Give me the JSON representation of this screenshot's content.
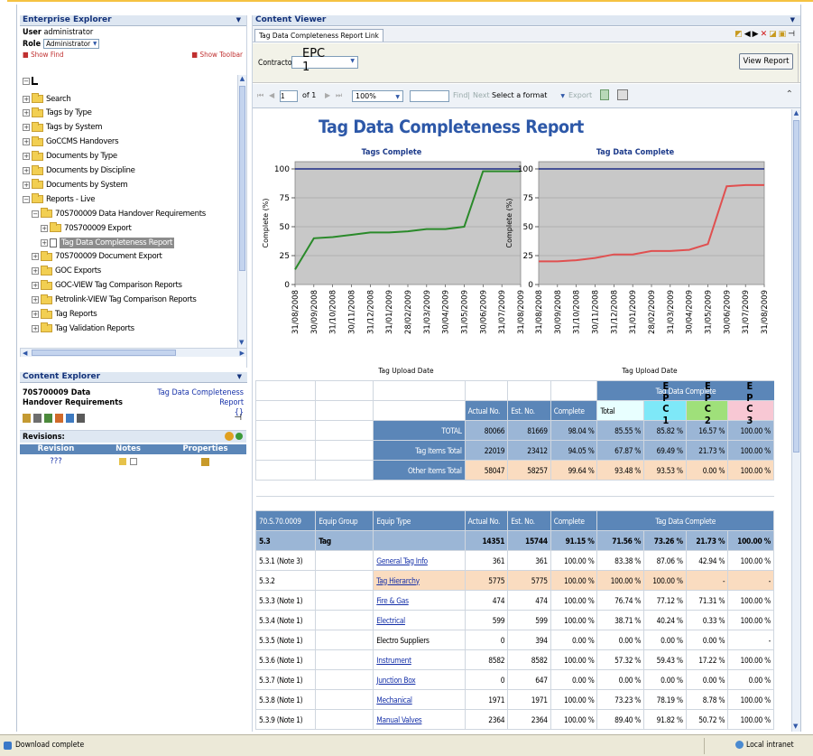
{
  "window": {
    "status": "Download complete",
    "zone": "Local intranet"
  },
  "enterprise_explorer": {
    "title": "Enterprise Explorer",
    "user_label": "User",
    "user_value": "administrator",
    "role_label": "Role",
    "role_value": "Administrator",
    "show_find": "Show Find",
    "show_toolbar": "Show Toolbar",
    "tree": [
      {
        "label": "Search",
        "indent": 1,
        "type": "folder"
      },
      {
        "label": "Tags by Type",
        "indent": 1,
        "type": "folder"
      },
      {
        "label": "Tags by System",
        "indent": 1,
        "type": "folder"
      },
      {
        "label": "GoCCMS Handovers",
        "indent": 1,
        "type": "folder"
      },
      {
        "label": "Documents by Type",
        "indent": 1,
        "type": "folder"
      },
      {
        "label": "Documents by Discipline",
        "indent": 1,
        "type": "folder"
      },
      {
        "label": "Documents by System",
        "indent": 1,
        "type": "folder"
      },
      {
        "label": "Reports - Live",
        "indent": 1,
        "type": "folder"
      },
      {
        "label": "70S700009 Data Handover Requirements",
        "indent": 2,
        "type": "folder"
      },
      {
        "label": "70S700009 Export",
        "indent": 3,
        "type": "folder"
      },
      {
        "label": "Tag Data Completeness Report",
        "indent": 3,
        "type": "doc"
      },
      {
        "label": "70S700009 Document Export",
        "indent": 2,
        "type": "folder"
      },
      {
        "label": "GOC Exports",
        "indent": 2,
        "type": "folder"
      },
      {
        "label": "GOC-VIEW Tag Comparison Reports",
        "indent": 2,
        "type": "folder"
      },
      {
        "label": "Petrolink-VIEW Tag Comparison Reports",
        "indent": 2,
        "type": "folder"
      },
      {
        "label": "Tag Reports",
        "indent": 2,
        "type": "folder"
      },
      {
        "label": "Tag Validation Reports",
        "indent": 2,
        "type": "folder"
      }
    ]
  },
  "content_explorer": {
    "title": "Content Explorer",
    "doc_title": "70S700009 Data Handover Requirements",
    "report_link": "Tag Data Completeness Report",
    "braces": "{}",
    "revisions_label": "Revisions:",
    "columns": [
      "Revision",
      "Notes",
      "Properties"
    ],
    "revision_value": "???"
  },
  "content_viewer": {
    "title": "Content Viewer",
    "tab_label": "Tag Data Completeness Report Link",
    "contractor_label": "Contractor",
    "contractor_value": "EPC 1",
    "view_report": "View Report",
    "toolbar": {
      "page_value": "1",
      "of_pages": "of 1",
      "zoom": "100%",
      "find": "Find",
      "separator": "|",
      "next": "Next",
      "format": "Select a format",
      "export": "Export"
    }
  },
  "report": {
    "title": "Tag Data Completeness Report",
    "summary": {
      "group_header": "Tag Data Complete",
      "columns": [
        "Actual No.",
        "Est. No.",
        "Complete",
        "Total",
        "EPC 1",
        "EPC 2",
        "EPC 3"
      ],
      "rows": [
        {
          "label": "TOTAL",
          "values": [
            "80066",
            "81669",
            "98.04 %",
            "85.55 %",
            "85.82 %",
            "16.57 %",
            "100.00 %"
          ]
        },
        {
          "label": "Tag Items Total",
          "values": [
            "22019",
            "23412",
            "94.05 %",
            "67.87 %",
            "69.49 %",
            "21.73 %",
            "100.00 %"
          ]
        },
        {
          "label": "Other Items Total",
          "values": [
            "58047",
            "58257",
            "99.64 %",
            "93.48 %",
            "93.53 %",
            "0.00 %",
            "100.00 %"
          ]
        }
      ]
    },
    "detail": {
      "headers": [
        "70.S.70.0009",
        "Equip Group",
        "Equip Type",
        "Actual No.",
        "Est. No.",
        "Complete",
        "Tag Data Complete"
      ],
      "group_row": [
        "5.3",
        "Tag",
        "",
        "14351",
        "15744",
        "91.15 %",
        "71.56 %",
        "73.26 %",
        "21.73 %",
        "100.00 %"
      ],
      "rows": [
        [
          "5.3.1 (Note 3)",
          "",
          "General Tag Info",
          "361",
          "361",
          "100.00 %",
          "83.38 %",
          "87.06 %",
          "42.94 %",
          "100.00 %"
        ],
        [
          "5.3.2",
          "",
          "Tag Hierarchy",
          "5775",
          "5775",
          "100.00 %",
          "100.00 %",
          "100.00 %",
          "-",
          "-"
        ],
        [
          "5.3.3 (Note 1)",
          "",
          "Fire & Gas",
          "474",
          "474",
          "100.00 %",
          "76.74 %",
          "77.12 %",
          "71.31 %",
          "100.00 %"
        ],
        [
          "5.3.4 (Note 1)",
          "",
          "Electrical",
          "599",
          "599",
          "100.00 %",
          "38.71 %",
          "40.24 %",
          "0.33 %",
          "100.00 %"
        ],
        [
          "5.3.5 (Note 1)",
          "",
          "Electro Suppliers",
          "0",
          "394",
          "0.00 %",
          "0.00 %",
          "0.00 %",
          "0.00 %",
          "-"
        ],
        [
          "5.3.6 (Note 1)",
          "",
          "Instrument",
          "8582",
          "8582",
          "100.00 %",
          "57.32 %",
          "59.43 %",
          "17.22 %",
          "100.00 %"
        ],
        [
          "5.3.7 (Note 1)",
          "",
          "Junction Box",
          "0",
          "647",
          "0.00 %",
          "0.00 %",
          "0.00 %",
          "0.00 %",
          "0.00 %"
        ],
        [
          "5.3.8 (Note 1)",
          "",
          "Mechanical",
          "1971",
          "1971",
          "100.00 %",
          "73.23 %",
          "78.19 %",
          "8.78 %",
          "100.00 %"
        ],
        [
          "5.3.9 (Note 1)",
          "",
          "Manual Valves",
          "2364",
          "2364",
          "100.00 %",
          "89.40 %",
          "91.82 %",
          "50.72 %",
          "100.00 %"
        ]
      ]
    }
  },
  "chart_data": [
    {
      "type": "line",
      "title": "Tags Complete",
      "xlabel": "Tag Upload Date",
      "ylabel": "Complete (%)",
      "ylim": [
        0,
        100
      ],
      "grid": true,
      "categories": [
        "31/08/2008",
        "30/09/2008",
        "31/10/2008",
        "30/11/2008",
        "31/12/2008",
        "31/01/2009",
        "28/02/2009",
        "31/03/2009",
        "30/04/2009",
        "31/05/2009",
        "30/06/2009",
        "31/07/2009",
        "31/08/2009"
      ],
      "target": 100,
      "values": [
        13,
        40,
        41,
        43,
        45,
        45,
        46,
        48,
        48,
        50,
        98,
        98,
        98
      ]
    },
    {
      "type": "line",
      "title": "Tag Data Complete",
      "xlabel": "Tag Upload Date",
      "ylabel": "Complete (%)",
      "ylim": [
        0,
        100
      ],
      "grid": true,
      "categories": [
        "31/08/2008",
        "30/09/2008",
        "31/10/2008",
        "30/11/2008",
        "31/12/2008",
        "31/01/2009",
        "28/02/2009",
        "31/03/2009",
        "30/04/2009",
        "31/05/2009",
        "30/06/2009",
        "31/07/2009",
        "31/08/2009"
      ],
      "target": 100,
      "values": [
        20,
        20,
        21,
        23,
        26,
        26,
        29,
        29,
        30,
        35,
        85,
        86,
        86
      ]
    }
  ],
  "colors": {
    "target_line": "#1c2a86",
    "tags_series": "#2a8a2a",
    "data_series": "#e05050",
    "plot_bg": "#c8c8c8"
  }
}
